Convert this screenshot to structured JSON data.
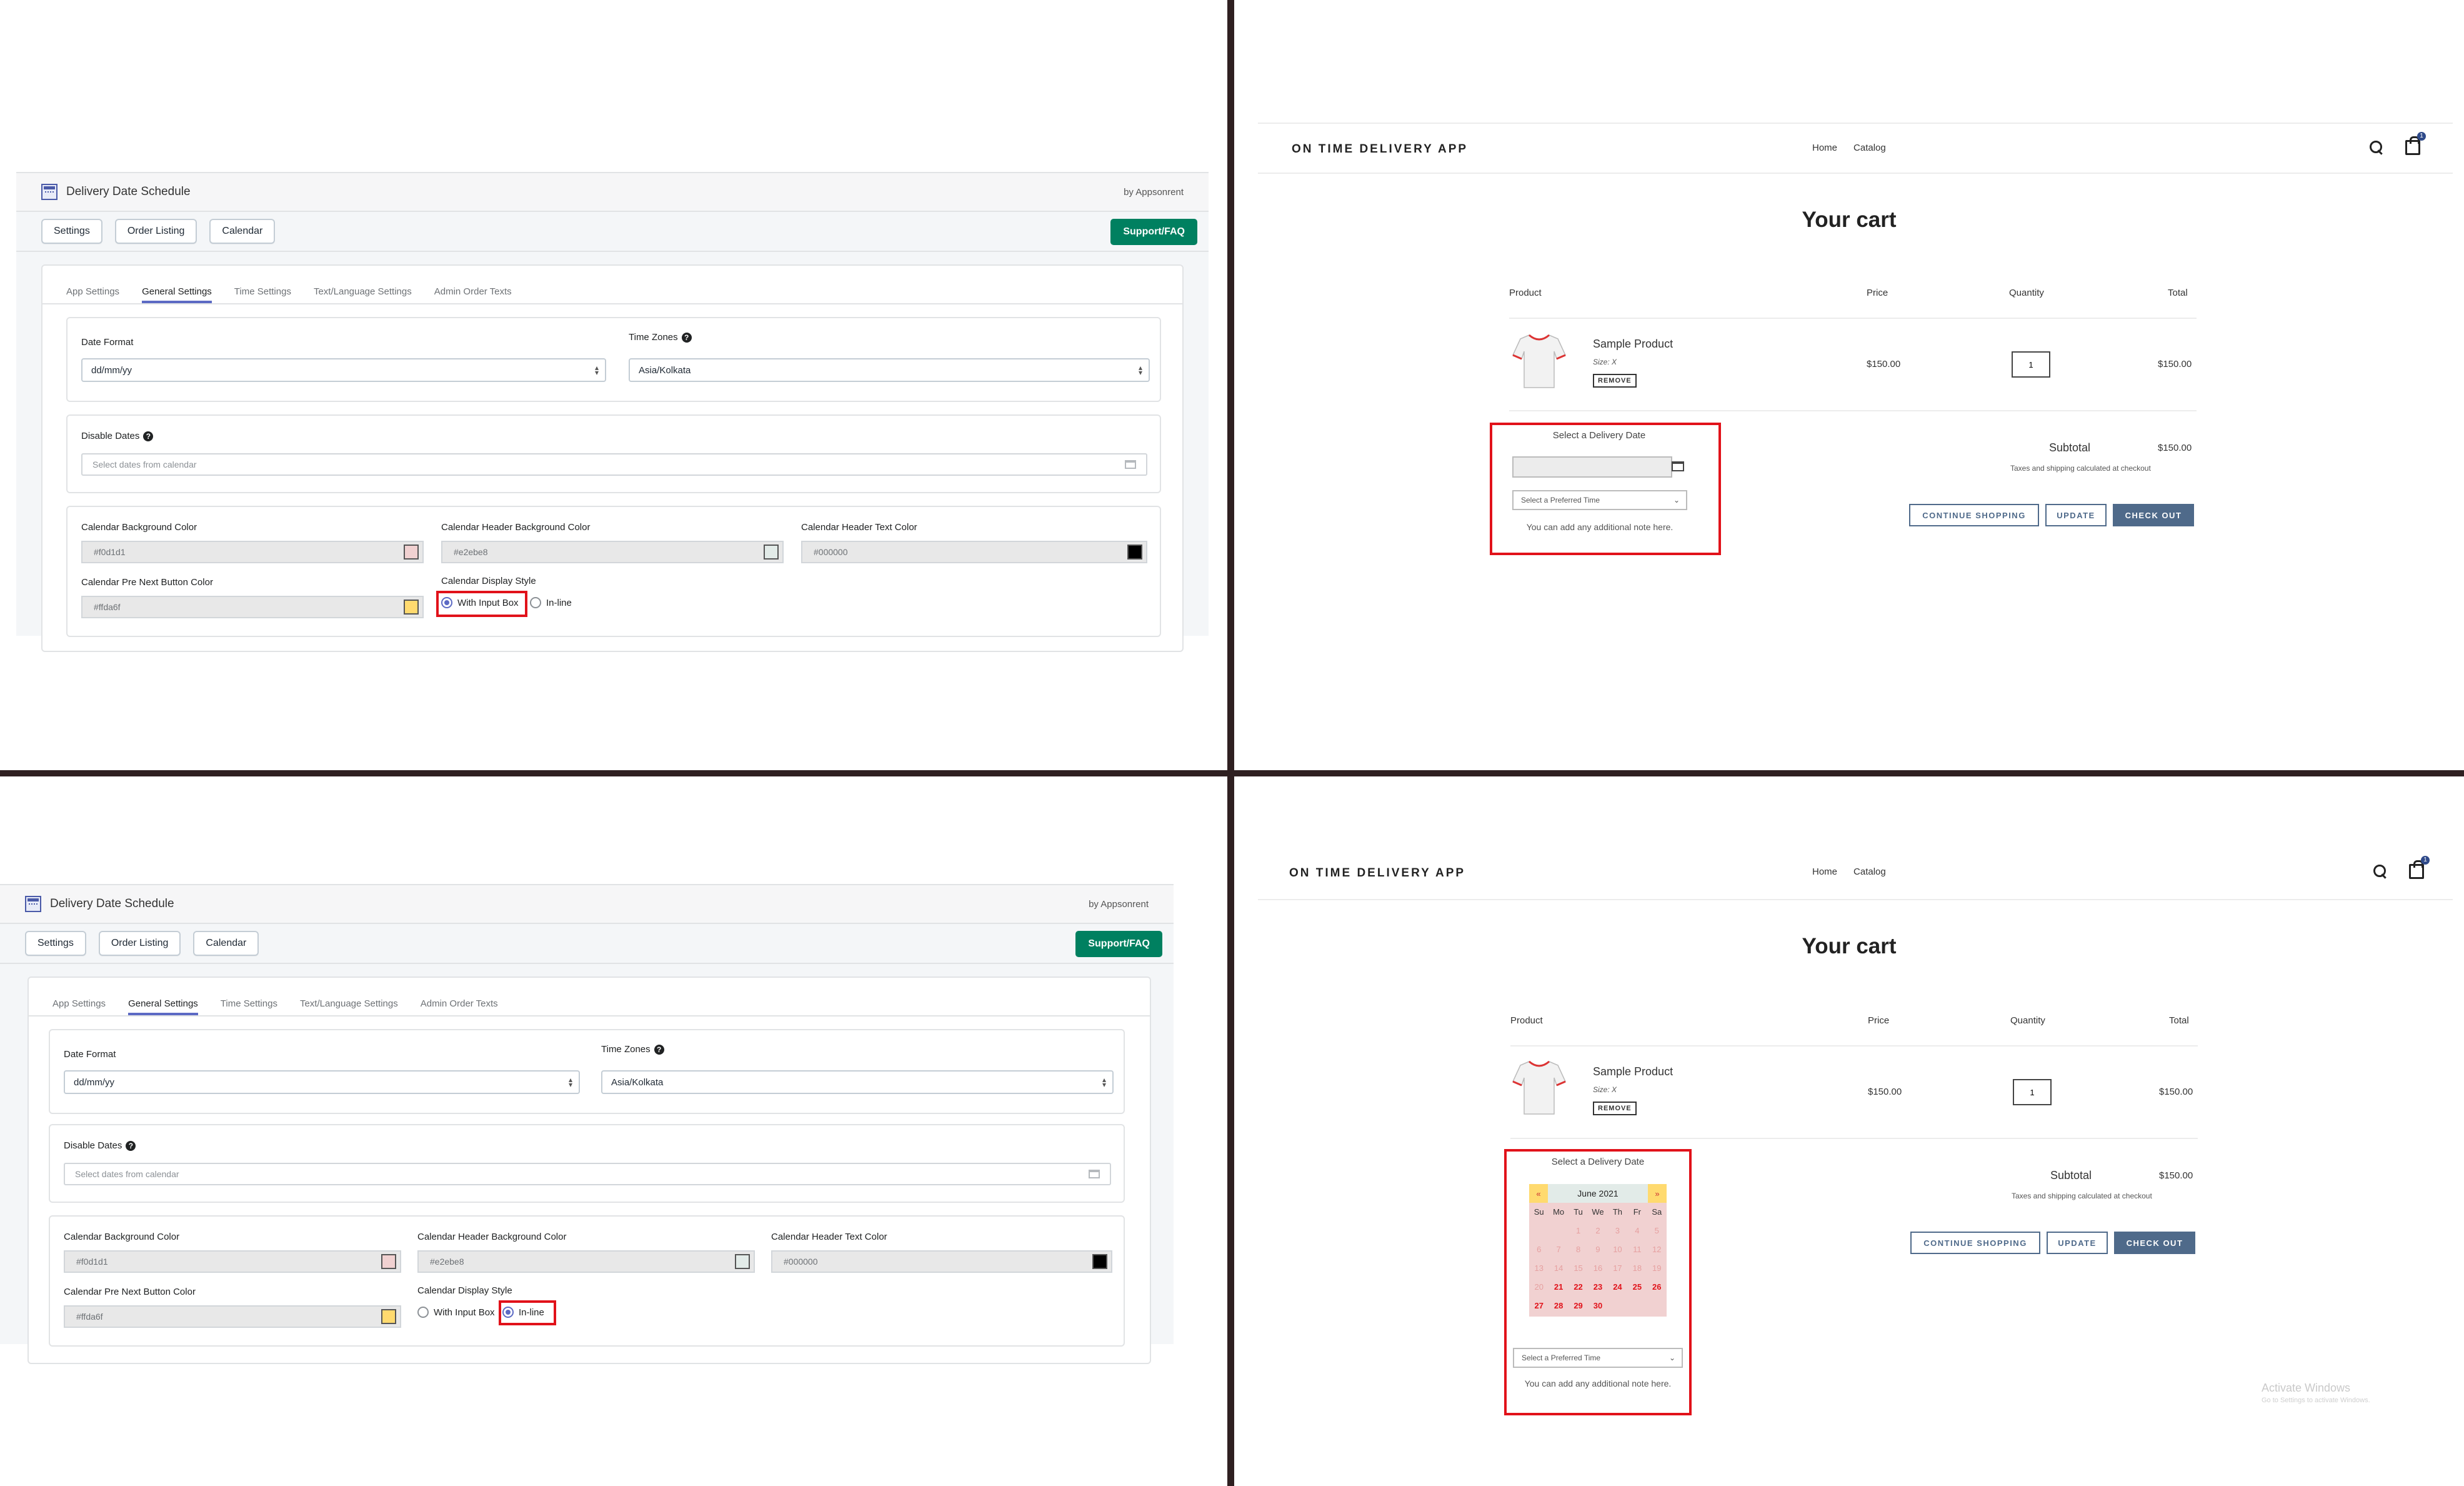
{
  "admin": {
    "app_title": "Delivery Date Schedule",
    "by": "by Appsonrent",
    "nav_buttons": [
      "Settings",
      "Order Listing",
      "Calendar"
    ],
    "support_label": "Support/FAQ",
    "tabs": [
      "App Settings",
      "General Settings",
      "Time Settings",
      "Text/Language Settings",
      "Admin Order Texts"
    ],
    "active_tab": "General Settings",
    "date_format_label": "Date Format",
    "date_format_value": "dd/mm/yy",
    "time_zones_label": "Time Zones",
    "time_zone_value": "Asia/Kolkata",
    "disable_dates_label": "Disable Dates",
    "disable_dates_placeholder": "Select dates from calendar",
    "cal_bg_label": "Calendar Background Color",
    "cal_bg_value": "#f0d1d1",
    "cal_header_bg_label": "Calendar Header Background Color",
    "cal_header_bg_value": "#e2ebe8",
    "cal_header_text_label": "Calendar Header Text Color",
    "cal_header_text_value": "#000000",
    "cal_prenext_label": "Calendar Pre Next Button Color",
    "cal_prenext_value": "#ffda6f",
    "display_style_label": "Calendar Display Style",
    "opt_input_box": "With Input Box",
    "opt_inline": "In-line",
    "top_selected": "With Input Box",
    "bottom_selected": "In-line"
  },
  "colors": {
    "cal_bg": "#f1d1d1",
    "cal_header_bg": "#e2ebe8",
    "cal_header_text": "#000000",
    "cal_prenext": "#ffda6f",
    "support_green": "#008060",
    "highlight_red": "#e1121a",
    "store_button": "#4f6a8a"
  },
  "store": {
    "brand": "ON TIME DELIVERY APP",
    "nav": [
      "Home",
      "Catalog"
    ],
    "cart_count": "1",
    "title": "Your cart",
    "col_product": "Product",
    "col_price": "Price",
    "col_quantity": "Quantity",
    "col_total": "Total",
    "product_name": "Sample Product",
    "product_size": "Size: X",
    "remove": "REMOVE",
    "price": "$150.00",
    "quantity": "1",
    "total": "$150.00",
    "subtotal_label": "Subtotal",
    "subtotal": "$150.00",
    "tax_note": "Taxes and shipping calculated at checkout",
    "btn_continue": "CONTINUE SHOPPING",
    "btn_update": "UPDATE",
    "btn_checkout": "CHECK OUT",
    "delivery_title": "Select a Delivery Date",
    "time_placeholder": "Select a Preferred Time",
    "note": "You can add any additional note here.",
    "calendar": {
      "prev": "«",
      "next": "»",
      "month": "June 2021",
      "day_names": [
        "Su",
        "Mo",
        "Tu",
        "We",
        "Th",
        "Fr",
        "Sa"
      ],
      "days": [
        "",
        "",
        "1",
        "2",
        "3",
        "4",
        "5",
        "6",
        "7",
        "8",
        "9",
        "10",
        "11",
        "12",
        "13",
        "14",
        "15",
        "16",
        "17",
        "18",
        "19",
        "20",
        "21",
        "22",
        "23",
        "24",
        "25",
        "26",
        "27",
        "28",
        "29",
        "30",
        "",
        "",
        ""
      ],
      "first_available": 21
    }
  },
  "watermark": {
    "title": "Activate Windows",
    "sub": "Go to Settings to activate Windows."
  }
}
